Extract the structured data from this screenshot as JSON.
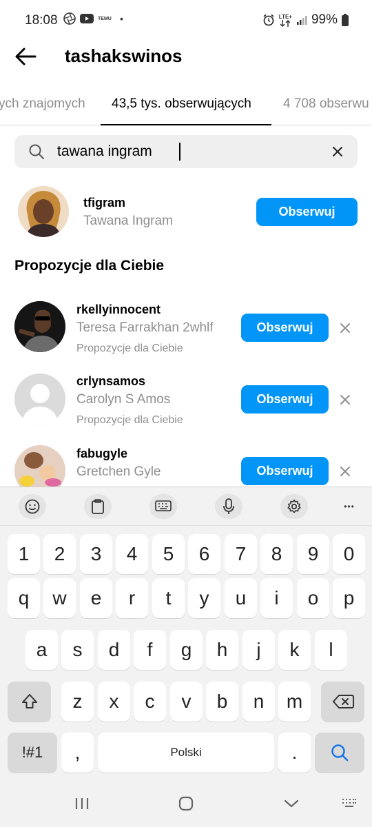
{
  "status_bar": {
    "time": "18:08",
    "notif_icons": [
      "aperture-icon",
      "youtube-icon",
      "temu-icon"
    ],
    "temu_label": "TEMU",
    "dot": "•",
    "lte_label": "LTE+",
    "battery": "99%"
  },
  "header": {
    "title": "tashakswinos"
  },
  "tabs": [
    {
      "label": "ych znajomych"
    },
    {
      "label": "43,5 tys. obserwujących"
    },
    {
      "label": "4 708 obserwu"
    }
  ],
  "search": {
    "value": "tawana ingram",
    "placeholder": ""
  },
  "result": {
    "username": "tfigram",
    "full_name": "Tawana Ingram",
    "button": "Obserwuj"
  },
  "suggestions": {
    "title": "Propozycje dla Ciebie",
    "items": [
      {
        "username": "rkellyinnocent",
        "full_name": "Teresa Farrakhan 2whlf",
        "subtext": "Propozycje dla Ciebie",
        "button": "Obserwuj"
      },
      {
        "username": "crlynsamos",
        "full_name": "Carolyn S Amos",
        "subtext": "Propozycje dla Ciebie",
        "button": "Obserwuj"
      },
      {
        "username": "fabugyle",
        "full_name": "Gretchen Gyle",
        "subtext": "",
        "button": "Obserwuj"
      }
    ]
  },
  "keyboard": {
    "number_row": [
      "1",
      "2",
      "3",
      "4",
      "5",
      "6",
      "7",
      "8",
      "9",
      "0"
    ],
    "row1": [
      "q",
      "w",
      "e",
      "r",
      "t",
      "y",
      "u",
      "i",
      "o",
      "p"
    ],
    "row2": [
      "a",
      "s",
      "d",
      "f",
      "g",
      "h",
      "j",
      "k",
      "l"
    ],
    "row3": [
      "z",
      "x",
      "c",
      "v",
      "b",
      "n",
      "m"
    ],
    "symbols_label": "!#1",
    "comma": ",",
    "space_label": "Polski",
    "period": ".",
    "more": "•••"
  },
  "colors": {
    "accent": "#0095f6",
    "secondary_text": "#8e8e8e"
  }
}
